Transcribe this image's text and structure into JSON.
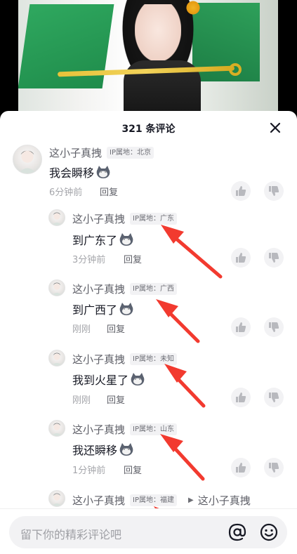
{
  "video": {
    "background": "#000000"
  },
  "sheet": {
    "title": "321 条评论",
    "close_icon": "close-icon"
  },
  "comments": [
    {
      "user": "这小子真拽",
      "ip": "IP属地：北京",
      "text": "我会瞬移",
      "time": "6分钟前",
      "reply": "回复"
    },
    {
      "user": "这小子真拽",
      "ip": "IP属地：广东",
      "text": "到广东了",
      "time": "3分钟前",
      "reply": "回复"
    },
    {
      "user": "这小子真拽",
      "ip": "IP属地：广西",
      "text": "到广西了",
      "time": "刚刚",
      "reply": "回复"
    },
    {
      "user": "这小子真拽",
      "ip": "IP属地：未知",
      "text": "我到火星了",
      "time": "刚刚",
      "reply": "回复"
    },
    {
      "user": "这小子真拽",
      "ip": "IP属地：山东",
      "text": "我还瞬移",
      "time": "1分钟前",
      "reply": "回复"
    },
    {
      "user": "这小子真拽",
      "ip": "IP属地：福建",
      "reply_to": "这小子真拽"
    }
  ],
  "input": {
    "placeholder": "留下你的精彩评论吧",
    "at_icon": "at-icon",
    "emoji_icon": "emoji-icon"
  },
  "colors": {
    "arrow": "#f23a2f",
    "text_primary": "#161823",
    "text_secondary": "#5f6068",
    "badge_bg": "#f2f2f4"
  }
}
